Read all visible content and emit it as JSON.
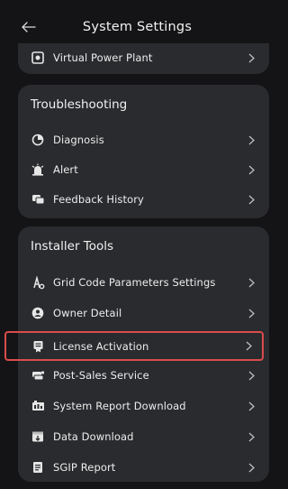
{
  "header": {
    "title": "System Settings"
  },
  "top_card": {
    "item": "Virtual Power Plant"
  },
  "troubleshooting": {
    "title": "Troubleshooting",
    "items": [
      "Diagnosis",
      "Alert",
      "Feedback History"
    ]
  },
  "installer": {
    "title": "Installer Tools",
    "items": [
      "Grid Code Parameters Settings",
      "Owner Detail",
      "License Activation",
      "Post-Sales Service",
      "System Report Download",
      "Data Download",
      "SGIP Report"
    ]
  },
  "colors": {
    "background": "#141416",
    "card": "#2a2b2e",
    "highlight": "#d94c4c"
  }
}
